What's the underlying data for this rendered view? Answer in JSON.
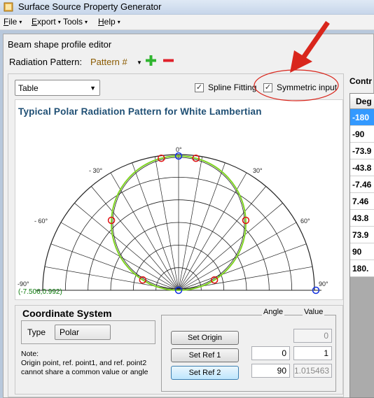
{
  "window": {
    "title": "Surface Source Property Generator"
  },
  "menu": [
    {
      "acc": "F",
      "rest": "ile",
      "arrow": "▾"
    },
    {
      "acc": "E",
      "rest": "xport",
      "arrow": "▾"
    },
    {
      "acc": "",
      "rest": "Tools",
      "arrow": "▾"
    },
    {
      "acc": "H",
      "rest": "elp",
      "arrow": "▾"
    }
  ],
  "editor": {
    "title": "Beam shape profile editor",
    "radiation_label": "Radiation Pattern:",
    "radiation_value": "Pattern #",
    "view_select": "Table",
    "spline_label": "Spline Fitting",
    "symmetric_label": "Symmetric input",
    "spline_checked": "✓",
    "symmetric_checked": "✓"
  },
  "chart": {
    "title": "Typical Polar Radiation Pattern for White Lambertian",
    "angle_labels": [
      "0°",
      "30°",
      "- 30°",
      "60°",
      "- 60°",
      "90°",
      "-90°"
    ],
    "coord_readout": "(-7.506,0.992)"
  },
  "coordinate_system": {
    "title": "Coordinate System",
    "type_label": "Type",
    "type_value": "Polar",
    "note_lines": [
      "Note:",
      "Origin point, ref. point1, and ref. point2",
      "cannot share a common value or angle"
    ],
    "angle_header": "Angle",
    "value_header": "Value",
    "buttons": [
      {
        "label": "Set Origin",
        "angle": "",
        "value": "0"
      },
      {
        "label": "Set Ref 1",
        "angle": "0",
        "value": "1"
      },
      {
        "label": "Set Ref 2",
        "angle": "90",
        "value": "1.015463"
      }
    ]
  },
  "control_points": {
    "label": "Contr",
    "column_header": "Deg",
    "rows": [
      "-180",
      "-90",
      "-73.9",
      "-43.8",
      "-7.46",
      "7.46",
      "43.8",
      "73.9",
      "90",
      "180."
    ]
  },
  "colors": {
    "accent": "#3399ff",
    "annotation": "#d9261c",
    "fit_curve": "#7ed321"
  },
  "icons": [
    "app-icon",
    "add-icon",
    "remove-icon",
    "dropdown-arrow-icon",
    "checkbox-icon"
  ]
}
